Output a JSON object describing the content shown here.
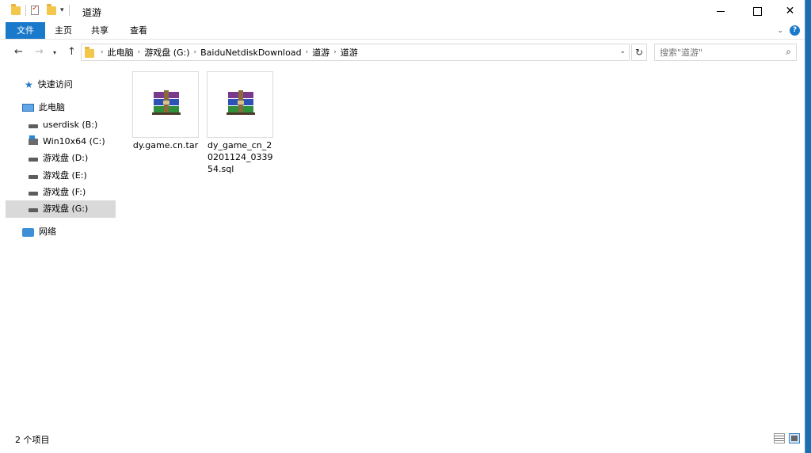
{
  "window": {
    "title": "道游",
    "controls": {
      "minimize": "minimize",
      "maximize": "maximize",
      "close": "✕"
    }
  },
  "ribbon": {
    "tabs": [
      {
        "label": "文件"
      },
      {
        "label": "主页"
      },
      {
        "label": "共享"
      },
      {
        "label": "查看"
      }
    ],
    "help": "?"
  },
  "address": {
    "crumbs": [
      "此电脑",
      "游戏盘 (G:)",
      "BaiduNetdiskDownload",
      "道游",
      "道游"
    ]
  },
  "search": {
    "placeholder": "搜索\"道游\""
  },
  "navpane": {
    "quick_access": "快速访问",
    "this_pc": "此电脑",
    "drives": [
      {
        "label": "userdisk (B:)"
      },
      {
        "label": "Win10x64 (C:)"
      },
      {
        "label": "游戏盘 (D:)"
      },
      {
        "label": "游戏盘 (E:)"
      },
      {
        "label": "游戏盘 (F:)"
      },
      {
        "label": "游戏盘 (G:)"
      }
    ],
    "network": "网络"
  },
  "files": [
    {
      "name": "dy.game.cn.tar",
      "icon": "winrar-archive-icon"
    },
    {
      "name": "dy_game_cn_20201124_033954.sql",
      "icon": "winrar-archive-icon"
    }
  ],
  "status": {
    "item_count": "2 个项目"
  },
  "colors": {
    "accent": "#1979ca",
    "selection": "#d9d9d9"
  }
}
